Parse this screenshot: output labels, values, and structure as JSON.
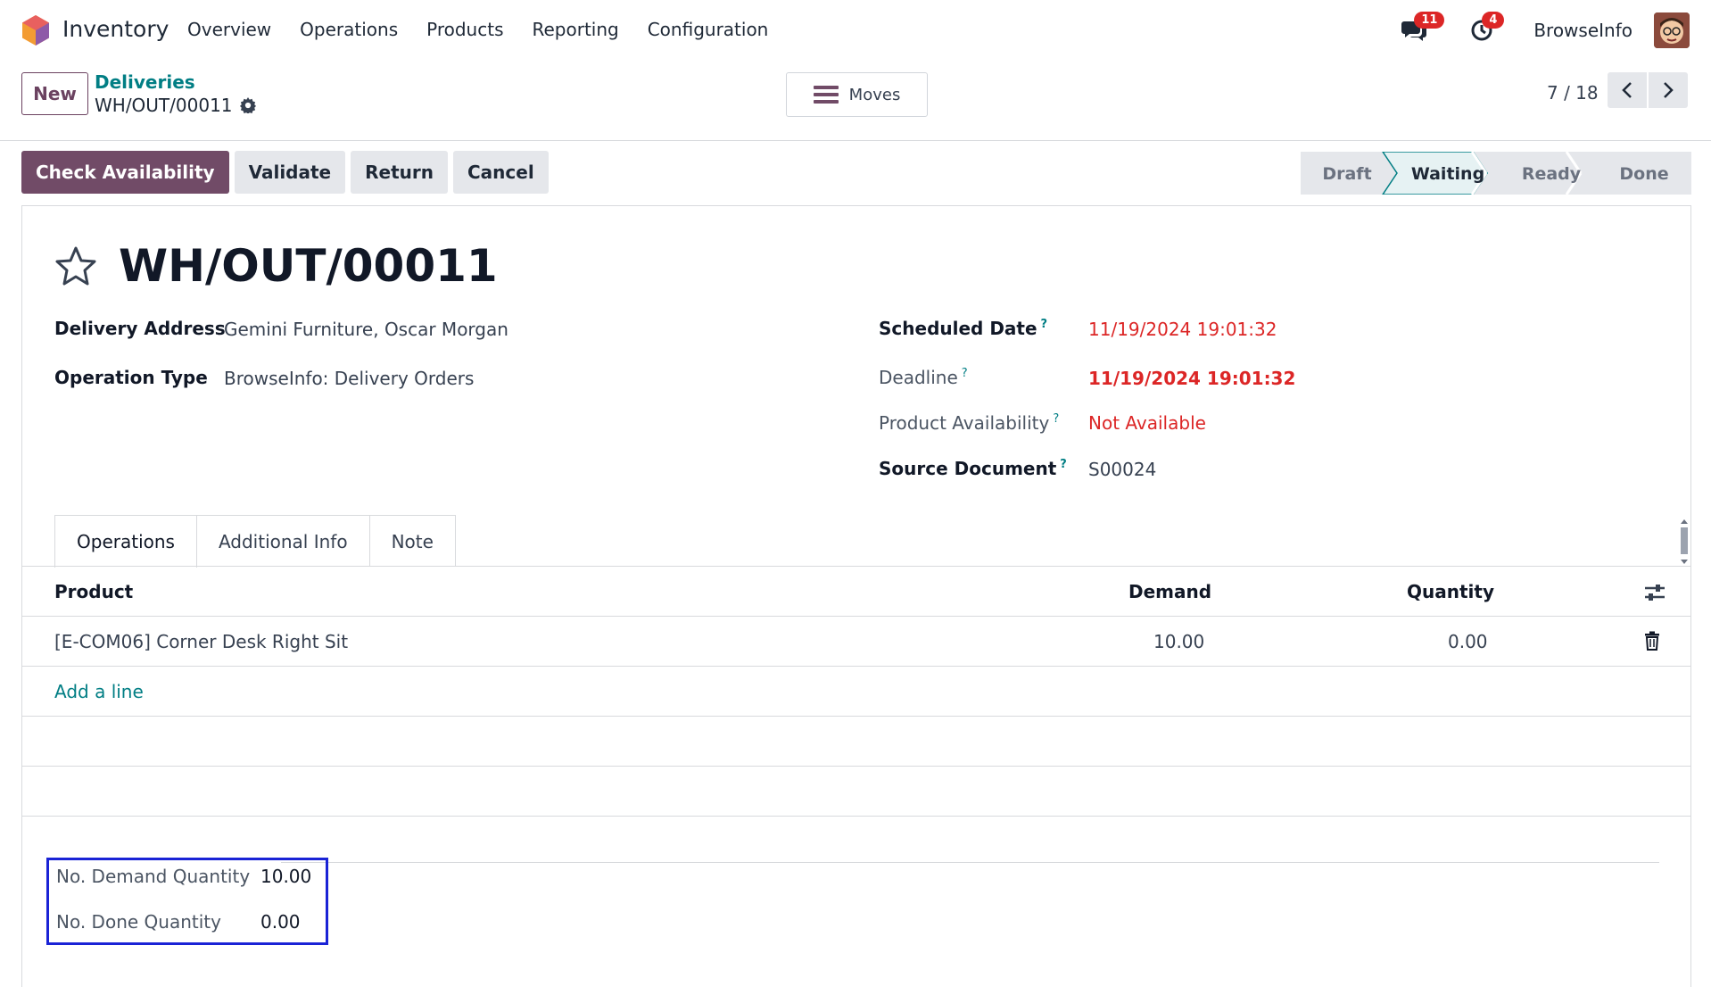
{
  "navbar": {
    "app_name": "Inventory",
    "menu": [
      "Overview",
      "Operations",
      "Products",
      "Reporting",
      "Configuration"
    ],
    "messages_count": "11",
    "activities_count": "4",
    "company": "BrowseInfo"
  },
  "control_panel": {
    "new_label": "New",
    "breadcrumb_parent": "Deliveries",
    "breadcrumb_current": "WH/OUT/00011",
    "moves_label": "Moves",
    "pager": "7 / 18"
  },
  "actions": {
    "check_availability": "Check Availability",
    "validate": "Validate",
    "return": "Return",
    "cancel": "Cancel"
  },
  "status_stages": [
    "Draft",
    "Waiting",
    "Ready",
    "Done"
  ],
  "status_active": "Waiting",
  "record": {
    "title": "WH/OUT/00011",
    "delivery_address_label": "Delivery Address",
    "delivery_address": "Gemini Furniture, Oscar Morgan",
    "operation_type_label": "Operation Type",
    "operation_type": "BrowseInfo: Delivery Orders",
    "scheduled_date_label": "Scheduled Date",
    "scheduled_date": "11/19/2024 19:01:32",
    "deadline_label": "Deadline",
    "deadline": "11/19/2024 19:01:32",
    "availability_label": "Product Availability",
    "availability": "Not Available",
    "source_document_label": "Source Document",
    "source_document": "S00024",
    "help_mark": "?"
  },
  "tabs": [
    "Operations",
    "Additional Info",
    "Note"
  ],
  "table": {
    "columns": {
      "product": "Product",
      "demand": "Demand",
      "quantity": "Quantity"
    },
    "rows": [
      {
        "product": "[E-COM06] Corner Desk Right Sit",
        "demand": "10.00",
        "quantity": "0.00"
      }
    ],
    "add_line": "Add a line"
  },
  "totals": {
    "demand_label": "No. Demand Quantity",
    "demand_value": "10.00",
    "done_label": "No. Done Quantity",
    "done_value": "0.00"
  },
  "colors": {
    "primary": "#714b67",
    "link": "#017e84",
    "danger": "#dc2626",
    "highlight_box": "#1a23d6"
  }
}
